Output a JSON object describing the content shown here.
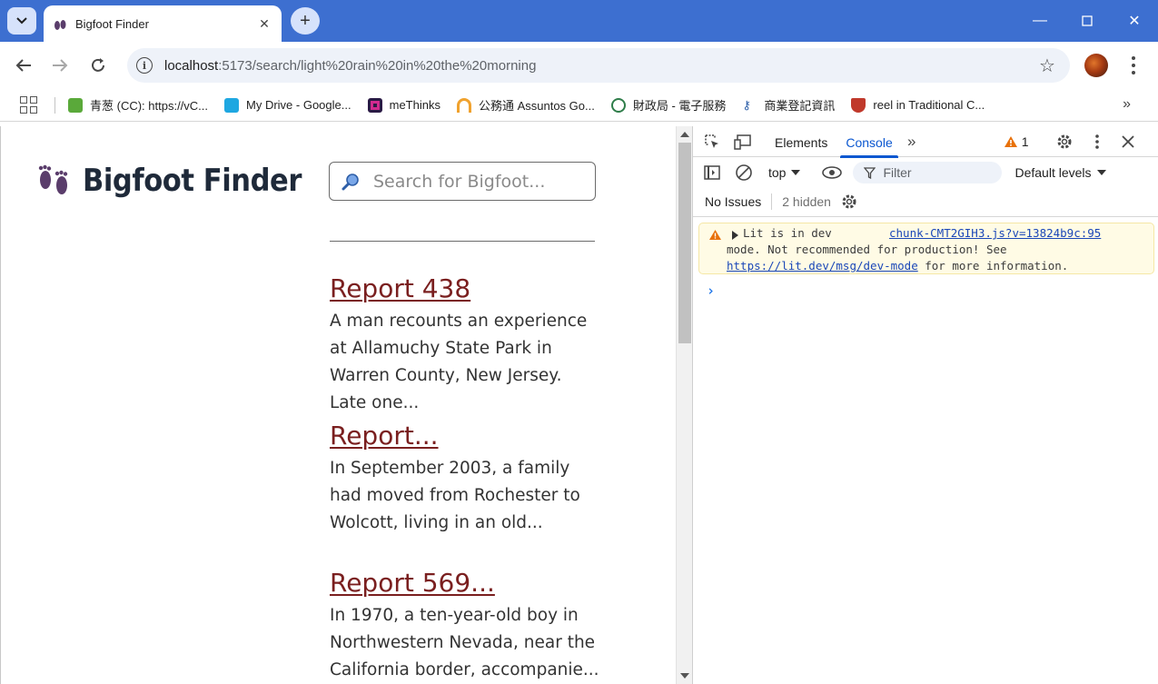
{
  "browser": {
    "tab_title": "Bigfoot Finder",
    "url_host": "localhost",
    "url_path": ":5173/search/light%20rain%20in%20the%20morning",
    "colors": {
      "titlebar": "#3d6fd0",
      "accent": "#0b57d0"
    }
  },
  "bookmarks": [
    {
      "label": "青葱 (CC): https://vC...",
      "icon": "green-square-icon",
      "color": "#5aa93a"
    },
    {
      "label": "My Drive - Google...",
      "icon": "drive-icon",
      "color": "#1ea7e1"
    },
    {
      "label": "meThinks",
      "icon": "methinks-icon",
      "color": "#2a1a45"
    },
    {
      "label": "公務通 Assuntos Go...",
      "icon": "gov-arc-icon",
      "color": "#f0a22e"
    },
    {
      "label": "財政局 - 電子服務",
      "icon": "finance-seal-icon",
      "color": "#2f7d4a"
    },
    {
      "label": "商業登記資訊",
      "icon": "key-icon",
      "color": "#2d5fa8"
    },
    {
      "label": "reel in Traditional C...",
      "icon": "shield-crest-icon",
      "color": "#c0392b"
    }
  ],
  "page": {
    "brand": "Bigfoot Finder",
    "search_placeholder": "Search for Bigfoot...",
    "results": [
      {
        "title": "Report 438",
        "snippet": "A man recounts an experience at Allamuchy State Park in Warren County, New Jersey. Late one..."
      },
      {
        "title": "Report...",
        "snippet": "In September 2003, a family had moved from Rochester to Wolcott, living in an old..."
      },
      {
        "title": "Report 569...",
        "snippet": "In 1970, a ten-year-old boy in Northwestern Nevada, near the California border, accompanie..."
      }
    ],
    "link_color": "#7a1f1f"
  },
  "devtools": {
    "tabs": [
      "Elements",
      "Console"
    ],
    "active_tab": "Console",
    "warning_count": "1",
    "context": "top",
    "filter_placeholder": "Filter",
    "levels": "Default levels",
    "no_issues": "No Issues",
    "hidden_count": "2 hidden",
    "message": {
      "line1": "Lit is in dev",
      "source": "chunk-CMT2GIH3.js?v=13824b9c:95",
      "line2": "mode. Not recommended for production! See",
      "link": "https://lit.dev/msg/dev-mode",
      "line3_rest": " for more information."
    }
  }
}
